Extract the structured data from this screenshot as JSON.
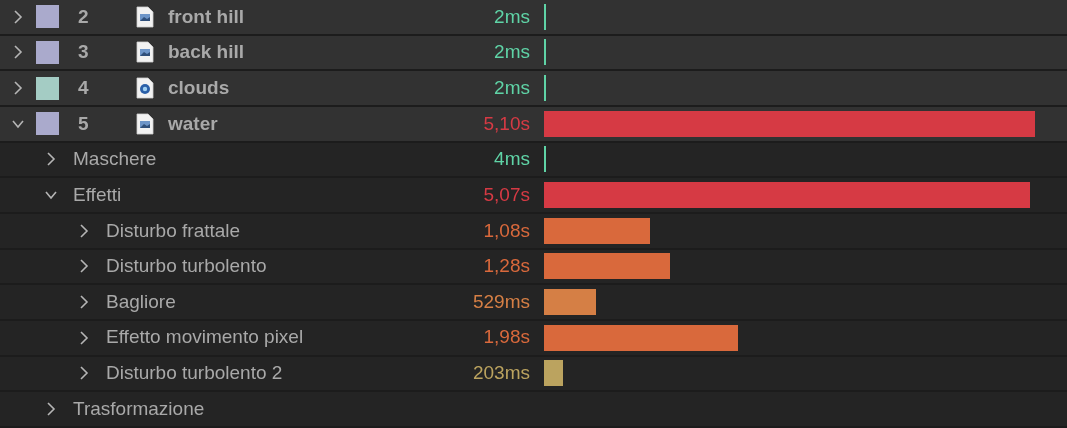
{
  "layers": [
    {
      "number": "2",
      "name": "front hill",
      "label": {
        "color": "#aaaacc"
      },
      "kind": "image",
      "expanded": false,
      "time": "2ms",
      "color": "#5fd3a6"
    },
    {
      "number": "3",
      "name": "back hill",
      "label": {
        "color": "#aaaacc"
      },
      "kind": "image",
      "expanded": false,
      "time": "2ms",
      "color": "#5fd3a6"
    },
    {
      "number": "4",
      "name": "clouds",
      "label": {
        "color": "#a4ccc4"
      },
      "kind": "media",
      "expanded": false,
      "time": "2ms",
      "color": "#5fd3a6"
    },
    {
      "number": "5",
      "name": "water",
      "label": {
        "color": "#aaaacc"
      },
      "kind": "image",
      "expanded": true,
      "time": "5,10s",
      "color": "#d63a44",
      "level": 0.953,
      "children": [
        {
          "name": "Maschere",
          "expanded": false,
          "time": "4ms",
          "color": "#5fd3a6"
        },
        {
          "name": "Effetti",
          "expanded": true,
          "time": "5,07s",
          "color": "#d63a44",
          "level": 0.943,
          "children": [
            {
              "name": "Disturbo frattale",
              "expanded": false,
              "time": "1,08s",
              "color": "#d9693c"
            },
            {
              "name": "Disturbo turbolento",
              "expanded": false,
              "time": "1,28s",
              "color": "#d9693c"
            },
            {
              "name": "Bagliore",
              "expanded": false,
              "time": "529ms",
              "color": "#d57f45"
            },
            {
              "name": "Effetto movimento pixel",
              "expanded": false,
              "time": "1,98s",
              "color": "#d9693c"
            },
            {
              "name": "Disturbo turbolento 2",
              "expanded": false,
              "time": "203ms",
              "color": "#bba35f"
            }
          ]
        },
        {
          "name": "Trasformazione",
          "expanded": false
        }
      ]
    }
  ]
}
